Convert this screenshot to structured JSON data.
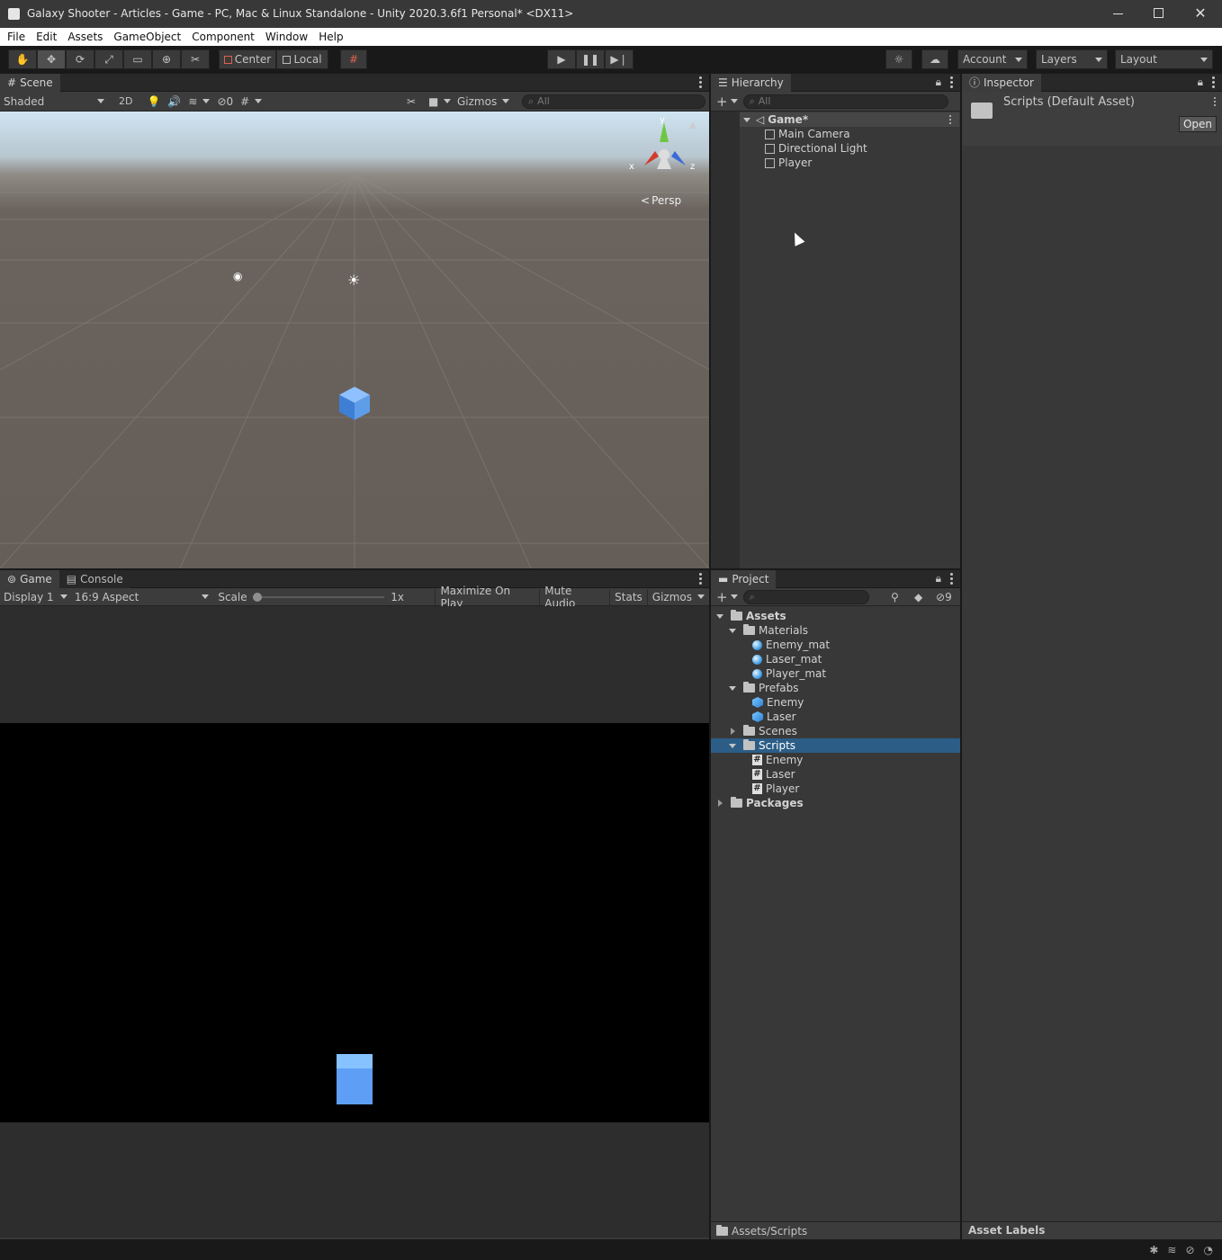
{
  "window": {
    "title": "Galaxy Shooter - Articles - Game - PC, Mac & Linux Standalone - Unity 2020.3.6f1 Personal* <DX11>",
    "controls": [
      "minimize-icon",
      "maximize-icon",
      "close-icon"
    ]
  },
  "menu": [
    "File",
    "Edit",
    "Assets",
    "GameObject",
    "Component",
    "Window",
    "Help"
  ],
  "toolbar": {
    "tools": [
      "hand-tool-icon",
      "move-tool-icon",
      "rotate-tool-icon",
      "scale-tool-icon",
      "rect-tool-icon",
      "transform-tool-icon",
      "custom-tool-icon"
    ],
    "pivot": "Center",
    "space": "Local",
    "account": "Account",
    "layers": "Layers",
    "layout": "Layout"
  },
  "scene": {
    "tab": "Scene",
    "shading": "Shaded",
    "mode2d": "2D",
    "hidden_count": "0",
    "gizmos": "Gizmos",
    "search_placeholder": "All",
    "persp": "Persp",
    "axis": {
      "y": "y",
      "x": "x",
      "z": "z"
    }
  },
  "hierarchy": {
    "tab": "Hierarchy",
    "search_placeholder": "All",
    "root": "Game*",
    "items": [
      "Main Camera",
      "Directional Light",
      "Player"
    ]
  },
  "inspector": {
    "tab": "Inspector",
    "title": "Scripts (Default Asset)",
    "open_button": "Open",
    "footer": "Asset Labels"
  },
  "game": {
    "tabs": [
      "Game",
      "Console"
    ],
    "display": "Display 1",
    "aspect": "16:9 Aspect",
    "scale_label": "Scale",
    "scale_value": "1x",
    "scale_fraction": 0.0,
    "maximize": "Maximize On Play",
    "mute": "Mute Audio",
    "stats": "Stats",
    "gizmos": "Gizmos"
  },
  "project": {
    "tab": "Project",
    "hidden_count": "9",
    "path": "Assets/Scripts",
    "tree": {
      "assets": "Assets",
      "materials": "Materials",
      "materials_items": [
        "Enemy_mat",
        "Laser_mat",
        "Player_mat"
      ],
      "prefabs": "Prefabs",
      "prefabs_items": [
        "Enemy",
        "Laser"
      ],
      "scenes": "Scenes",
      "scripts": "Scripts",
      "scripts_items": [
        "Enemy",
        "Laser",
        "Player"
      ],
      "packages": "Packages"
    }
  },
  "colors": {
    "selection": "#2c5d87",
    "panel": "#383838",
    "cube": "#5ea1f0"
  }
}
